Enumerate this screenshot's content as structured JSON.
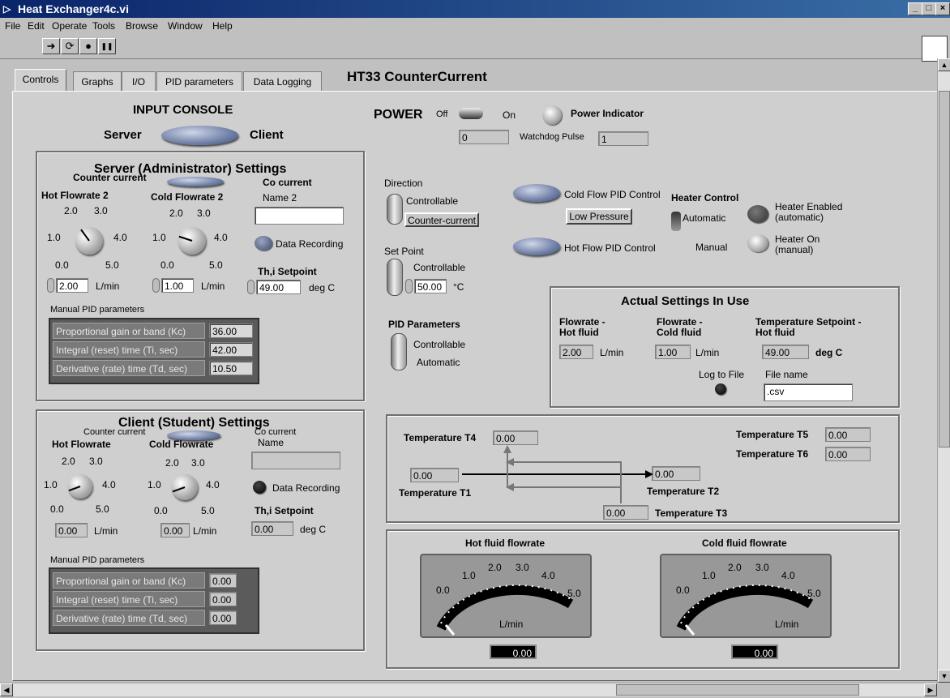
{
  "window": {
    "title": "Heat Exchanger4c.vi",
    "controls": [
      "_",
      "□",
      "×"
    ]
  },
  "menu": [
    "File",
    "Edit",
    "Operate",
    "Tools",
    "Browse",
    "Window",
    "Help"
  ],
  "toolbar": {
    "run": "➜",
    "run_cont": "⟳",
    "abort": "●",
    "pause": "❚❚"
  },
  "tabs": [
    "Controls",
    "Graphs",
    "I/O",
    "PID parameters",
    "Data Logging"
  ],
  "header": {
    "title": "HT33 CounterCurrent"
  },
  "input_console": {
    "title": "INPUT CONSOLE",
    "server": "Server",
    "client": "Client"
  },
  "power": {
    "label": "POWER",
    "off": "Off",
    "on": "On",
    "indicator": "Power Indicator",
    "value": "0",
    "watchdog_label": "Watchdog Pulse",
    "watchdog_value": "1"
  },
  "server": {
    "title": "Server (Administrator) Settings",
    "counter": "Counter current",
    "co": "Co current",
    "hot_label": "Hot Flowrate 2",
    "cold_label": "Cold Flowrate 2",
    "ticks": {
      "t0": "0.0",
      "t1": "1.0",
      "t2": "2.0",
      "t3": "3.0",
      "t4": "4.0",
      "t5": "5.0"
    },
    "name_label": "Name 2",
    "name_value": "",
    "recording": "Data Recording",
    "setpoint_label": "Th,i Setpoint",
    "hot_value": "2.00",
    "cold_value": "1.00",
    "setpoint_value": "49.00",
    "unit_flow": "L/min",
    "unit_temp": "deg C",
    "pid_title": "Manual PID parameters",
    "pid": [
      {
        "label": "Proportional gain or band (Kc)",
        "value": "36.00"
      },
      {
        "label": "Integral (reset) time (Ti, sec)",
        "value": "42.00"
      },
      {
        "label": "Derivative (rate) time (Td, sec)",
        "value": "10.50"
      }
    ]
  },
  "client": {
    "title": "Client (Student) Settings",
    "counter": "Counter current",
    "co": "Co current",
    "name_label": "Name",
    "hot_label": "Hot Flowrate",
    "cold_label": "Cold Flowrate",
    "recording": "Data Recording",
    "setpoint_label": "Th,i Setpoint",
    "hot_value": "0.00",
    "cold_value": "0.00",
    "setpoint_value": "0.00",
    "unit_flow": "L/min",
    "unit_temp": "deg C",
    "pid_title": "Manual PID parameters",
    "pid": [
      {
        "label": "Proportional gain or band (Kc)",
        "value": "0.00"
      },
      {
        "label": "Integral (reset) time (Ti, sec)",
        "value": "0.00"
      },
      {
        "label": "Derivative (rate) time (Td, sec)",
        "value": "0.00"
      }
    ]
  },
  "direction": {
    "label": "Direction",
    "mode": "Controllable",
    "value": "Counter-current"
  },
  "setpoint": {
    "label": "Set Point",
    "mode": "Controllable",
    "value": "50.00",
    "unit": "°C"
  },
  "pid_params": {
    "label": "PID Parameters",
    "controllable": "Controllable",
    "automatic": "Automatic"
  },
  "flow_ctrl": {
    "cold": "Cold Flow PID Control",
    "pressure": "Low Pressure",
    "hot": "Hot Flow PID Control"
  },
  "heater": {
    "title": "Heater Control",
    "automatic": "Automatic",
    "manual": "Manual",
    "enabled": "Heater Enabled (automatic)",
    "on": "Heater On (manual)"
  },
  "actual": {
    "title": "Actual Settings In Use",
    "hot_label": "Flowrate - Hot fluid",
    "cold_label": "Flowrate - Cold fluid",
    "temp_label": "Temperature Setpoint - Hot fluid",
    "hot_value": "2.00",
    "cold_value": "1.00",
    "temp_value": "49.00",
    "unit_flow": "L/min",
    "unit_temp": "deg C",
    "log": "Log to File",
    "file_label": "File name",
    "file_value": ".csv"
  },
  "temps": {
    "t1_label": "Temperature T1",
    "t1": "0.00",
    "t2_label": "Temperature T2",
    "t2": "0.00",
    "t3_label": "Temperature T3",
    "t3": "0.00",
    "t4_label": "Temperature T4",
    "t4": "0.00",
    "t5_label": "Temperature T5",
    "t5": "0.00",
    "t6_label": "Temperature T6",
    "t6": "0.00"
  },
  "gauges": {
    "hot_title": "Hot fluid flowrate",
    "cold_title": "Cold fluid flowrate",
    "unit": "L/min",
    "hot_value": "0.00",
    "cold_value": "0.00",
    "hot_level": 0.0,
    "cold_level": 0.0,
    "ticks": [
      "0.0",
      "1.0",
      "2.0",
      "3.0",
      "4.0",
      "5.0"
    ]
  }
}
